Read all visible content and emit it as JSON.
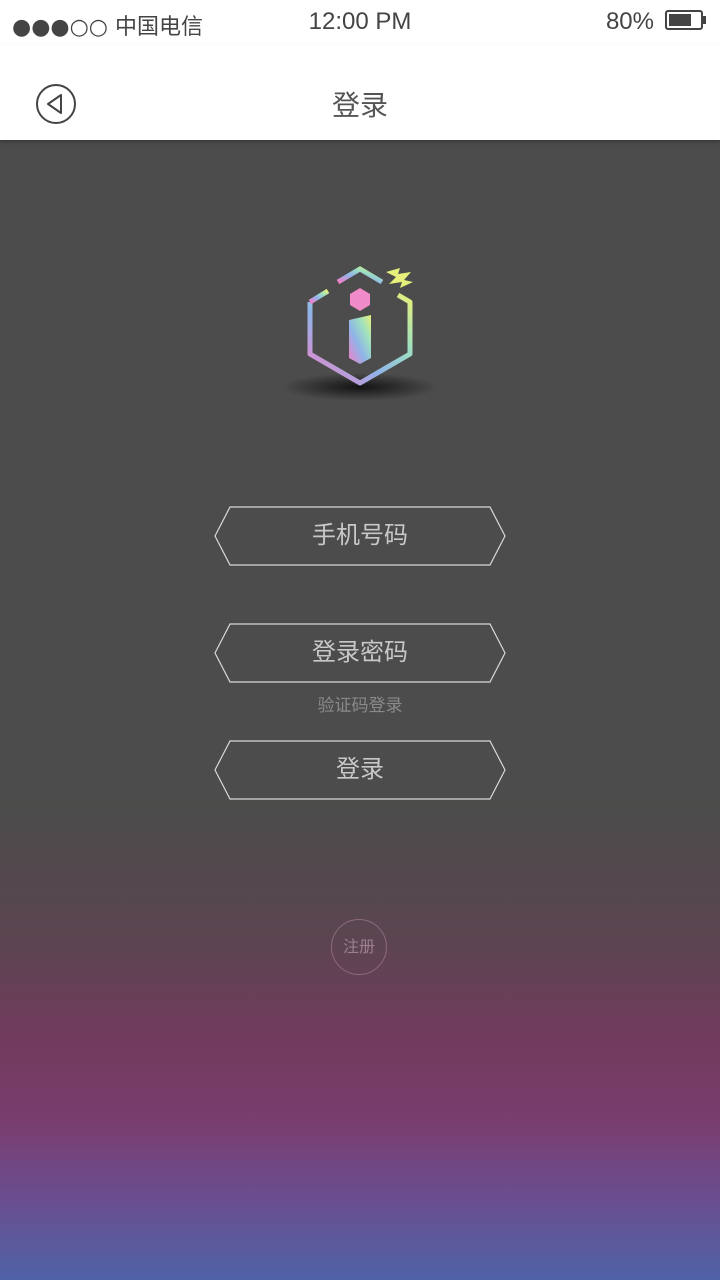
{
  "status_bar": {
    "carrier": "中国电信",
    "signal_dots": "●●●○○",
    "time": "12:00 PM",
    "battery": "80%",
    "battery_level": 0.8
  },
  "nav": {
    "title": "登录",
    "back_icon": "back-arrow-circle-icon"
  },
  "form": {
    "phone_placeholder": "手机号码",
    "password_placeholder": "登录密码",
    "sms_login_label": "验证码登录",
    "login_label": "登录"
  },
  "footer": {
    "register_label": "注册"
  },
  "colors": {
    "background_top": "#4b4c4b",
    "background_mid": "#713a5c",
    "background_bottom": "#4f62a6",
    "field_border": "#d9d9d9",
    "field_text": "#c8c8c8"
  }
}
